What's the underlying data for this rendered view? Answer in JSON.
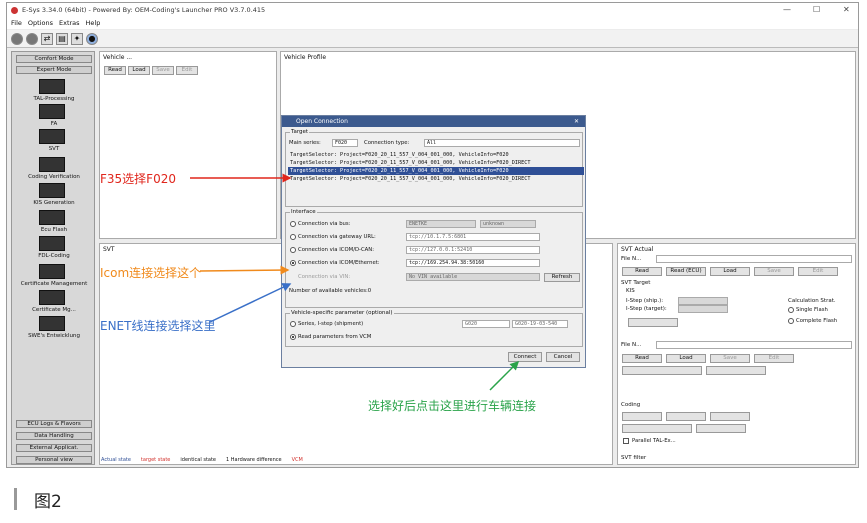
{
  "window": {
    "title": "E-Sys 3.34.0 (64bit) - Powered By: OEM-Coding's Launcher PRO V3.7.0.415",
    "minimize": "—",
    "maximize": "☐",
    "close": "✕"
  },
  "menu": [
    "File",
    "Options",
    "Extras",
    "Help"
  ],
  "left_panel": {
    "buttons_top": [
      "Comfort Mode",
      "Expert Mode"
    ],
    "items": [
      "TAL-Processing",
      "FA",
      "SVT",
      "Coding Verification",
      "KIS Generation",
      "Ecu Flash",
      "FDL-Coding",
      "Certificate Management",
      "Certificate Mg...",
      "SWE's Entwicklung"
    ],
    "buttons_bottom": [
      "ECU Logs & Flavors",
      "Data Handling",
      "External Applicat.",
      "Personal view"
    ]
  },
  "vehicle_panel": {
    "title": "Vehicle ...",
    "buttons": [
      "Read",
      "Load",
      "Save",
      "Edit"
    ]
  },
  "vehicle_profile": {
    "title": "Vehicle Profile"
  },
  "svt_panel": {
    "title": "SVT"
  },
  "right_panel": {
    "svt_actual": "SVT Actual",
    "file_label": "File N...",
    "buttons1": [
      "Read",
      "Read (ECU)",
      "Load",
      "Save",
      "Edit"
    ],
    "svt_target": "SVT Target",
    "kis": "KIS",
    "i_step_ship": "I-Step (ship.):",
    "i_step_target": "I-Step (target):",
    "calc_strategy": "Calculation Strat.",
    "single_flash": "Single Flash",
    "complete_flash": "Complete Flash",
    "file_label2": "File N...",
    "buttons2": [
      "Read",
      "Load",
      "Save",
      "Edit"
    ],
    "coding": "Coding",
    "parallel_tal": "Parallel TAL-Ex...",
    "svt_filter": "SVT filter"
  },
  "dialog": {
    "title": "Open Connection",
    "target_group": "Target",
    "main_series_label": "Main series:",
    "main_series_value": "F020",
    "conn_type_label": "Connection type:",
    "conn_type_value": "All",
    "targets": [
      "TargetSelector: Project=F020_20_11_557_V_004_001_000, VehicleInfo=F020",
      "TargetSelector: Project=F020_20_11_557_V_004_001_000, VehicleInfo=F020_DIRECT",
      "TargetSelector: Project=F020_20_11_557_V_004_001_000, VehicleInfo=F020",
      "TargetSelector: Project=F020_20_11_557_V_004_001_000, VehicleInfo=F020_DIRECT"
    ],
    "interface_group": "Interface",
    "interfaces": [
      {
        "label": "Connection via bus:",
        "value": "ENETKE",
        "extra": "unknown"
      },
      {
        "label": "Connection via gateway URL:",
        "value": "tcp://10.1.7.5:6801"
      },
      {
        "label": "Connection via ICOM/D-CAN:",
        "value": "tcp://127.0.0.1:52410"
      },
      {
        "label": "Connection via ICOM/Ethernet:",
        "value": "tcp://169.254.94.38:50160"
      }
    ],
    "conn_vin_label": "Connection via VIN:",
    "conn_vin_value": "No VIN available",
    "refresh": "Refresh",
    "available_vehicles": "Number of available vehicles:0",
    "vsp_group": "Vehicle-specific parameter (optional)",
    "series_label": "Series, I-step (shipment)",
    "series_value": "G020",
    "series_istep": "G020-19-03-540",
    "read_params": "Read parameters from VCM",
    "connect": "Connect",
    "cancel": "Cancel"
  },
  "status_legend": [
    "Actual state",
    "target state",
    "identical state",
    "1 Hardware difference",
    "VCM"
  ],
  "annotations": {
    "f35": "F35选择F020",
    "icom": "Icom连接选择这个",
    "enet": "ENET线连接选择这里",
    "connect": "选择好后点击这里进行车辆连接"
  },
  "caption": "图2",
  "colors": {
    "red": "#e0261c",
    "orange": "#f08a1c",
    "blue": "#3a70c8",
    "green": "#2aa34a",
    "selection": "#2f4f96"
  }
}
